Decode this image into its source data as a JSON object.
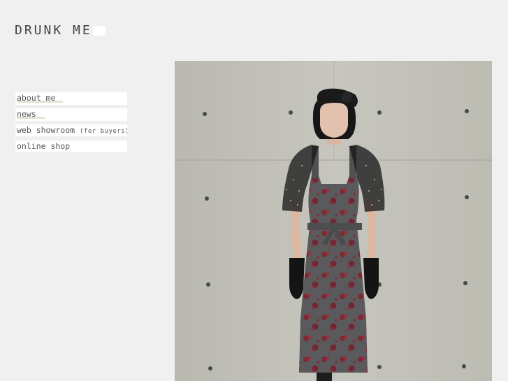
{
  "brand": {
    "logo_text": "DRUNK ME"
  },
  "nav": {
    "items": [
      {
        "label": "about me",
        "suffix": ""
      },
      {
        "label": "news",
        "suffix": ""
      },
      {
        "label": "web showroom",
        "suffix": "(for buyers)"
      },
      {
        "label": "online shop",
        "suffix": ""
      }
    ]
  },
  "colors": {
    "background": "#f0f0f0",
    "nav_bg": "#ffffff",
    "nav_underline": "#e4e2d4",
    "text": "#555555",
    "concrete": "#c2c2ba",
    "dress": "#5c5c5e",
    "dress_pattern": "#7d2a34"
  }
}
